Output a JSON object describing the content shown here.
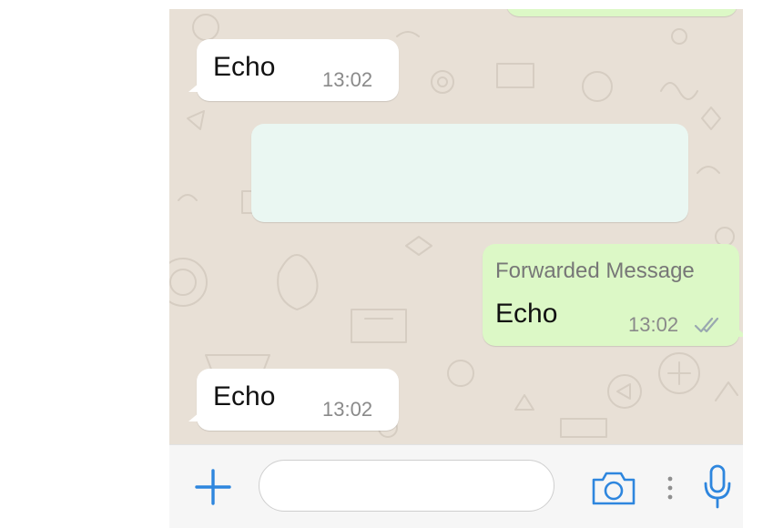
{
  "messages": [
    {
      "type": "incoming",
      "text": "Echo",
      "time": "13:02"
    },
    {
      "type": "incoming-blank"
    },
    {
      "type": "outgoing",
      "forwarded_label": "Forwarded Message",
      "text": "Echo",
      "time": "13:02",
      "status_icon": "double-check-icon"
    },
    {
      "type": "incoming",
      "text": "Echo",
      "time": "13:02"
    }
  ],
  "input_bar": {
    "add_icon": "plus-icon",
    "message_input": {
      "value": "",
      "placeholder": ""
    },
    "camera_icon": "camera-icon",
    "more_icon": "vertical-dots-icon",
    "mic_icon": "microphone-icon"
  },
  "colors": {
    "chat_background": "#e8e0d6",
    "incoming_bubble": "#ffffff",
    "outgoing_bubble": "#dcf8c6",
    "blank_bubble": "#eaf7f2",
    "accent_blue": "#2e86de",
    "timestamp_gray": "#8a8a8a",
    "read_check": "#9aa8b0"
  }
}
